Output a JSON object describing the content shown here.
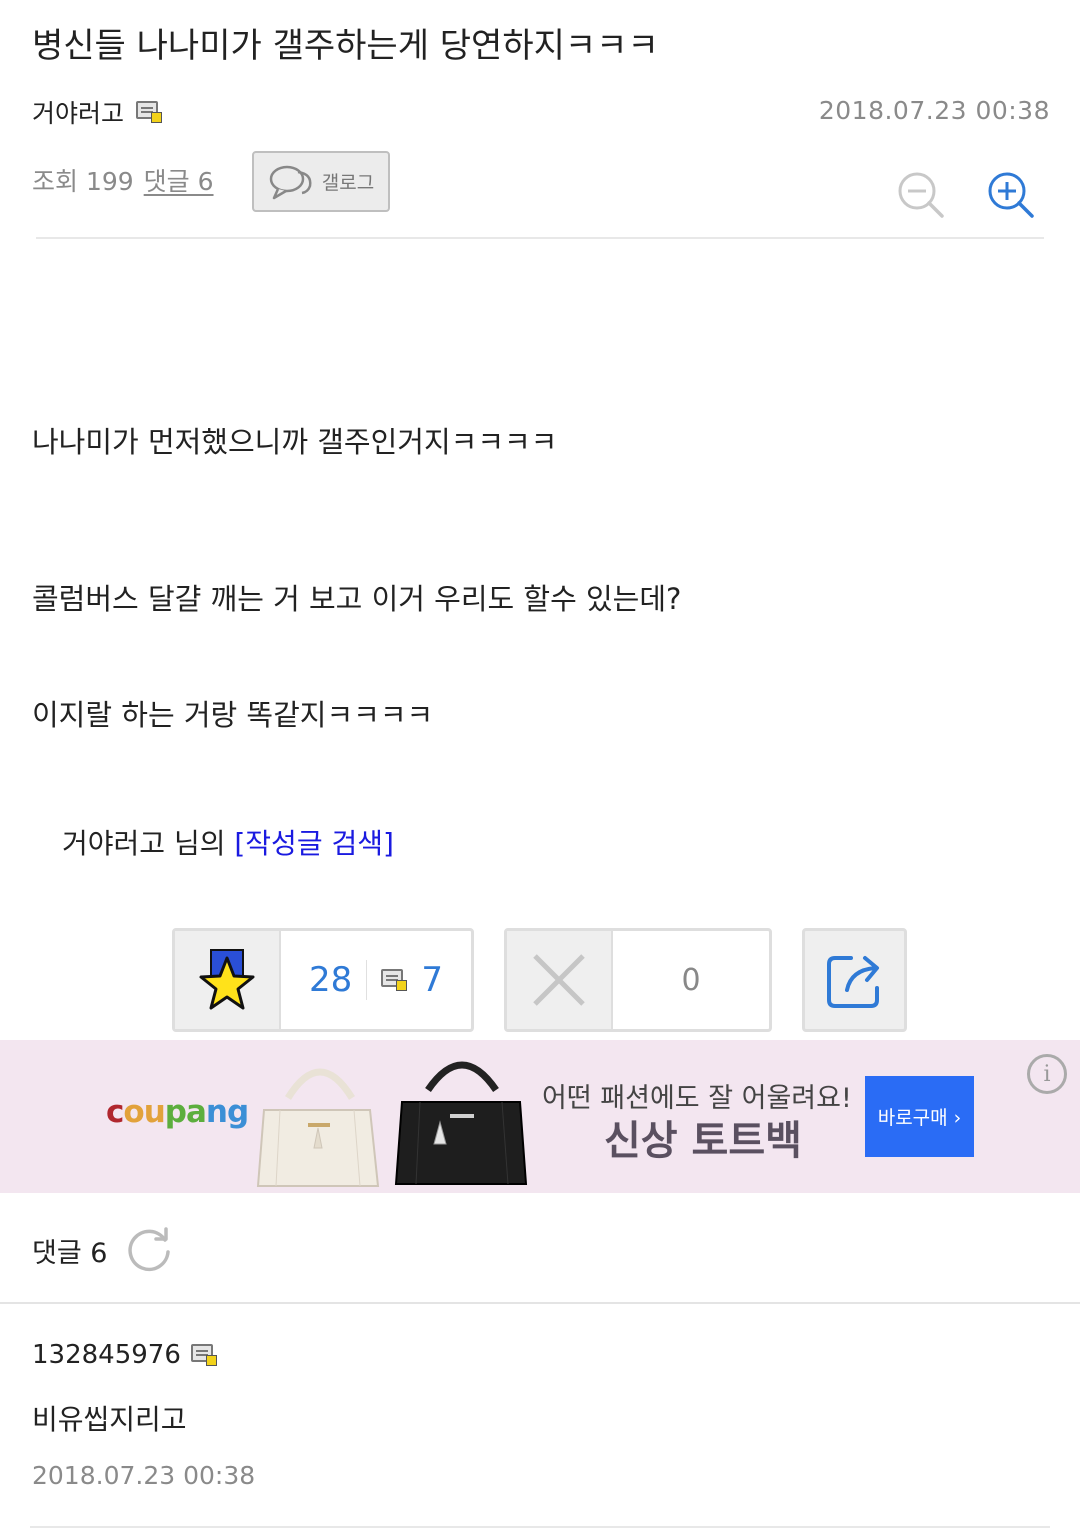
{
  "post": {
    "title": "병신들 나나미가 갤주하는게 당연하지ㅋㅋㅋ",
    "author": "거야러고",
    "date": "2018.07.23 00:38",
    "views_label": "조회 199",
    "comments_label": "댓글 6",
    "gallog_label": "갤로그",
    "body": [
      "나나미가 먼저했으니까 갤주인거지ㅋㅋㅋㅋ",
      "콜럼버스 달걀 깨는 거 보고 이거 우리도 할수 있는데?",
      "이지랄 하는 거랑 똑같지ㅋㅋㅋㅋ"
    ],
    "search_prefix": "거야러고 님의 ",
    "search_link": "[작성글 검색]"
  },
  "actions": {
    "recommend_count": "28",
    "fixed_recommend_count": "7",
    "nonrecommend_count": "0"
  },
  "ad": {
    "brand_parts": [
      "c",
      "ou",
      "pa",
      "ng"
    ],
    "tagline": "어떤 패션에도 잘 어울려요!",
    "product": "신상 토트백",
    "buy_label": "바로구매 ›",
    "info_label": "i"
  },
  "comments": {
    "header": "댓글 6",
    "items": [
      {
        "author": "132845976",
        "text": "비유씹지리고",
        "date": "2018.07.23 00:38"
      }
    ]
  },
  "colors": {
    "link": "#1a1ae0",
    "accent_blue": "#2f7ad6",
    "buy_button": "#2a6cf5",
    "ad_bg": "#f3e6f0"
  }
}
